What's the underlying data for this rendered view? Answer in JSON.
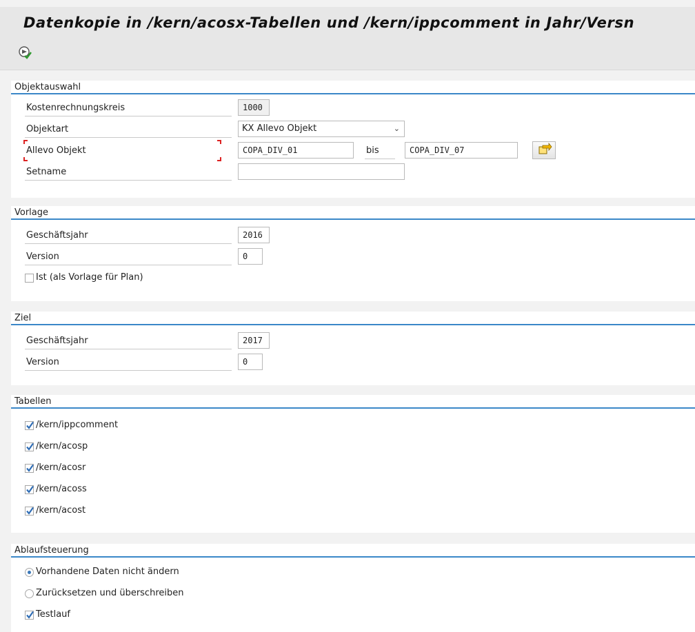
{
  "title": "Datenkopie in /kern/acosx-Tabellen und /kern/ippcomment in Jahr/Versn",
  "toolbar": {
    "execute_icon": "execute-icon"
  },
  "objektauswahl": {
    "header": "Objektauswahl",
    "kostenrechnungskreis_label": "Kostenrechnungskreis",
    "kostenrechnungskreis_value": "1000",
    "objektart_label": "Objektart",
    "objektart_value": "KX Allevo Objekt",
    "allevo_label": "Allevo Objekt",
    "allevo_from": "COPA_DIV_01",
    "bis_label": "bis",
    "allevo_to": "COPA_DIV_07",
    "setname_label": "Setname",
    "setname_value": ""
  },
  "vorlage": {
    "header": "Vorlage",
    "geschaeftsjahr_label": "Geschäftsjahr",
    "geschaeftsjahr_value": "2016",
    "version_label": "Version",
    "version_value": "0",
    "ist_label": "Ist (als Vorlage für Plan)",
    "ist_checked": false
  },
  "ziel": {
    "header": "Ziel",
    "geschaeftsjahr_label": "Geschäftsjahr",
    "geschaeftsjahr_value": "2017",
    "version_label": "Version",
    "version_value": "0"
  },
  "tabellen": {
    "header": "Tabellen",
    "items": [
      {
        "label": "/kern/ippcomment",
        "checked": true
      },
      {
        "label": "/kern/acosp",
        "checked": true
      },
      {
        "label": "/kern/acosr",
        "checked": true
      },
      {
        "label": "/kern/acoss",
        "checked": true
      },
      {
        "label": "/kern/acost",
        "checked": true
      }
    ]
  },
  "ablauf": {
    "header": "Ablaufsteuerung",
    "radio1_label": "Vorhandene Daten nicht ändern",
    "radio2_label": "Zurücksetzen und überschreiben",
    "testlauf_label": "Testlauf",
    "selected": "radio1",
    "testlauf_checked": true
  },
  "colors": {
    "accent": "#3a87c8",
    "check": "#2f6db5",
    "required": "#dd2222"
  }
}
